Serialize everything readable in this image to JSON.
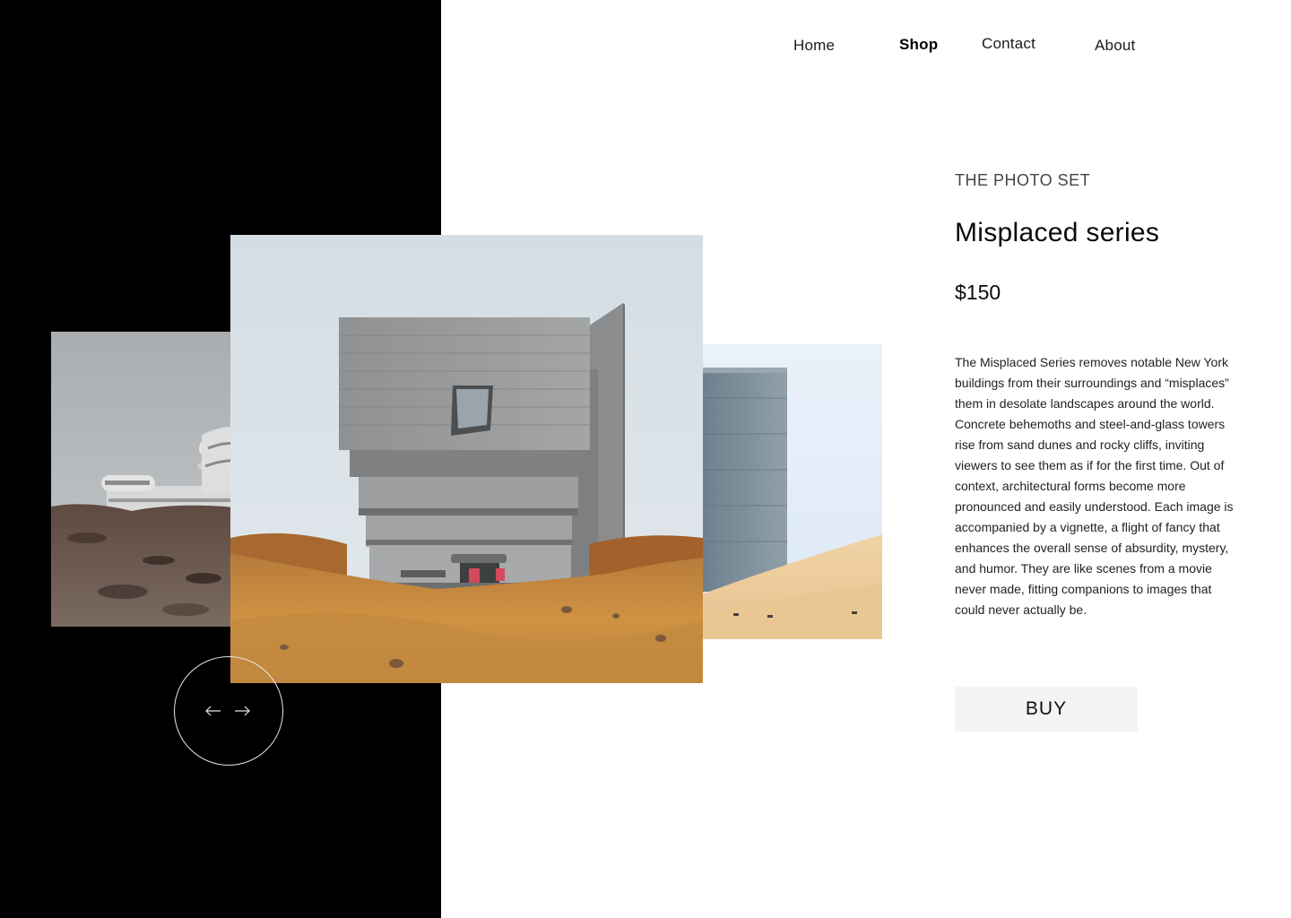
{
  "nav": {
    "items": [
      {
        "label": "Home",
        "active": false
      },
      {
        "label": "Shop",
        "active": true
      },
      {
        "label": "Contact",
        "active": false
      },
      {
        "label": "About",
        "active": false
      }
    ]
  },
  "product": {
    "eyebrow": "THE PHOTO SET",
    "title": "Misplaced series",
    "price": "$150",
    "description": "The Misplaced Series removes notable New York buildings from their surroundings and “misplaces” them in desolate landscapes around the world. Concrete behemoths and steel-and-glass towers rise from sand dunes and rocky cliffs, inviting viewers to see them as if for the first time. Out of context, architectural forms become more pronounced and easily understood. Each image is accompanied by a vignette, a flight of fancy that enhances the overall sense of absurdity, mystery, and humor. They are like scenes from a movie never made, fitting companions to images that could never actually be.",
    "buy_label": "BUY"
  },
  "carousel": {
    "prev_icon": "arrow-left-icon",
    "next_icon": "arrow-right-icon"
  },
  "colors": {
    "left_panel": "#000000",
    "button_bg": "#f4f4f4",
    "text": "#111111"
  }
}
